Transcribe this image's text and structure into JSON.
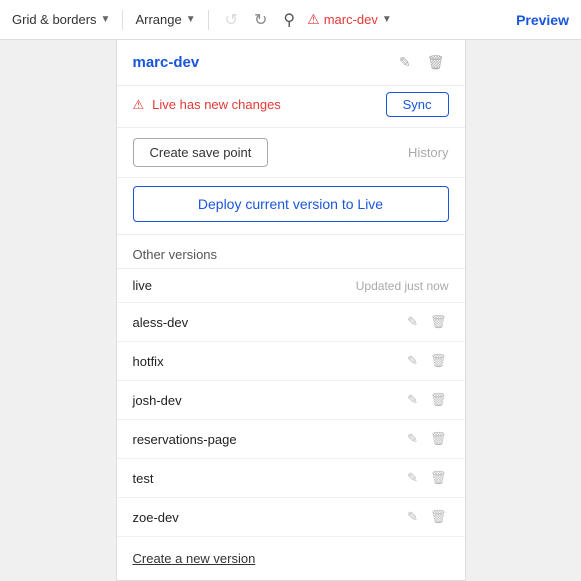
{
  "toolbar": {
    "grid_borders_label": "Grid & borders",
    "arrange_label": "Arrange",
    "undo_icon": "↺",
    "redo_icon": "↻",
    "search_icon": "⌕",
    "warning_label": "marc-dev",
    "preview_label": "Preview"
  },
  "panel": {
    "title": "marc-dev",
    "sync_warning": "Live has new changes",
    "sync_button": "Sync",
    "save_point_button": "Create save point",
    "history_link": "History",
    "deploy_button": "Deploy current version to Live",
    "other_versions_header": "Other versions",
    "versions": [
      {
        "name": "live",
        "badge": "Updated just now",
        "editable": false,
        "deletable": false
      },
      {
        "name": "aless-dev",
        "badge": "",
        "editable": true,
        "deletable": true
      },
      {
        "name": "hotfix",
        "badge": "",
        "editable": true,
        "deletable": true
      },
      {
        "name": "josh-dev",
        "badge": "",
        "editable": true,
        "deletable": true
      },
      {
        "name": "reservations-page",
        "badge": "",
        "editable": true,
        "deletable": true
      },
      {
        "name": "test",
        "badge": "",
        "editable": true,
        "deletable": true
      },
      {
        "name": "zoe-dev",
        "badge": "",
        "editable": true,
        "deletable": true
      }
    ],
    "create_new_link": "Create a new version"
  }
}
